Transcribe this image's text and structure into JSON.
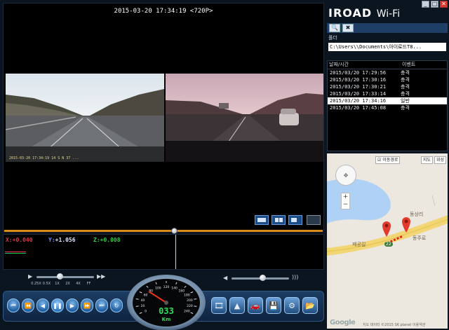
{
  "video": {
    "timestamp": "2015-03-20 17:34:19 <720P>",
    "front_overlay": "2015-03-20 17:34:19 14 S N 37 ..."
  },
  "gsensor": {
    "x": "+0.040",
    "y": "+1.056",
    "z": "+0.008",
    "x_color": "#e8334a",
    "y_color": "#3c78ff",
    "z_color": "#2fcf4a"
  },
  "playback_speed": {
    "labels": [
      "0.25X",
      "0.5X",
      "1X",
      "2X",
      "4X",
      "FF"
    ],
    "selected": "1X"
  },
  "speedometer": {
    "digits": "033",
    "unit": "Km",
    "ticks": [
      "0",
      "20",
      "40",
      "60",
      "80",
      "100",
      "120",
      "140",
      "160",
      "180",
      "200",
      "220",
      "240"
    ]
  },
  "app": {
    "logo": "IROAD",
    "logo_suffix": "Wi-Fi"
  },
  "panel": {
    "folder_label": "폴더",
    "folder_path": "C:\\Users\\\\Documents\\아이로드T8...",
    "col_datetime": "날짜/시간",
    "col_event": "이벤트",
    "files": [
      {
        "date": "2015/03/20 17:29:56",
        "event": "충격",
        "selected": false
      },
      {
        "date": "2015/03/20 17:30:16",
        "event": "충격",
        "selected": false
      },
      {
        "date": "2015/03/20 17:30:21",
        "event": "충격",
        "selected": false
      },
      {
        "date": "2015/03/20 17:33:14",
        "event": "충격",
        "selected": false
      },
      {
        "date": "2015/03/20 17:34:16",
        "event": "일반",
        "selected": true
      },
      {
        "date": "2015/03/20 17:45:08",
        "event": "충격",
        "selected": false
      }
    ]
  },
  "map": {
    "route_toggle": "이동경로",
    "type_map": "지도",
    "type_satellite": "위성",
    "place_label": "동상리",
    "road_label_left": "제공길",
    "road_label_right": "동주로",
    "route_number": "22",
    "footer": "지도 데이터 ©2015 SK planet   이용약관",
    "google": "Google",
    "accent_pin": "#e23b2e",
    "water": "#aed1f5"
  },
  "colors": {
    "seek_track": "#d88a1a",
    "control_bar": "#1d3d63",
    "selected_row_bg": "#ffffff"
  }
}
